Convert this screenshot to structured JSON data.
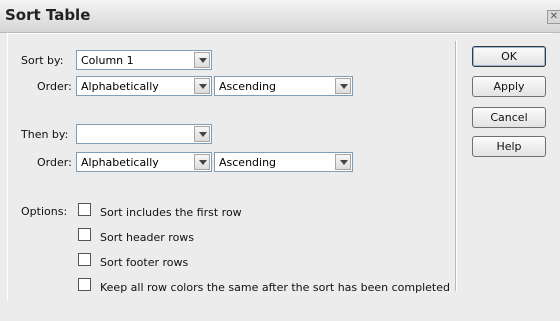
{
  "dialog": {
    "title": "Sort Table",
    "close_glyph": "✕"
  },
  "sort": {
    "sort_by_label": "Sort by:",
    "sort_by_value": "Column 1",
    "order_label": "Order:",
    "order_type": "Alphabetically",
    "order_direction": "Ascending"
  },
  "then": {
    "then_by_label": "Then by:",
    "then_by_value": "",
    "order_label": "Order:",
    "order_type": "Alphabetically",
    "order_direction": "Ascending"
  },
  "options": {
    "label": "Options:",
    "items": [
      {
        "label": "Sort includes the first row",
        "checked": false
      },
      {
        "label": "Sort header rows",
        "checked": false
      },
      {
        "label": "Sort footer rows",
        "checked": false
      },
      {
        "label": "Keep all row colors the same after the sort has been completed",
        "checked": false
      }
    ]
  },
  "buttons": {
    "ok": "OK",
    "apply": "Apply",
    "cancel": "Cancel",
    "help": "Help"
  }
}
